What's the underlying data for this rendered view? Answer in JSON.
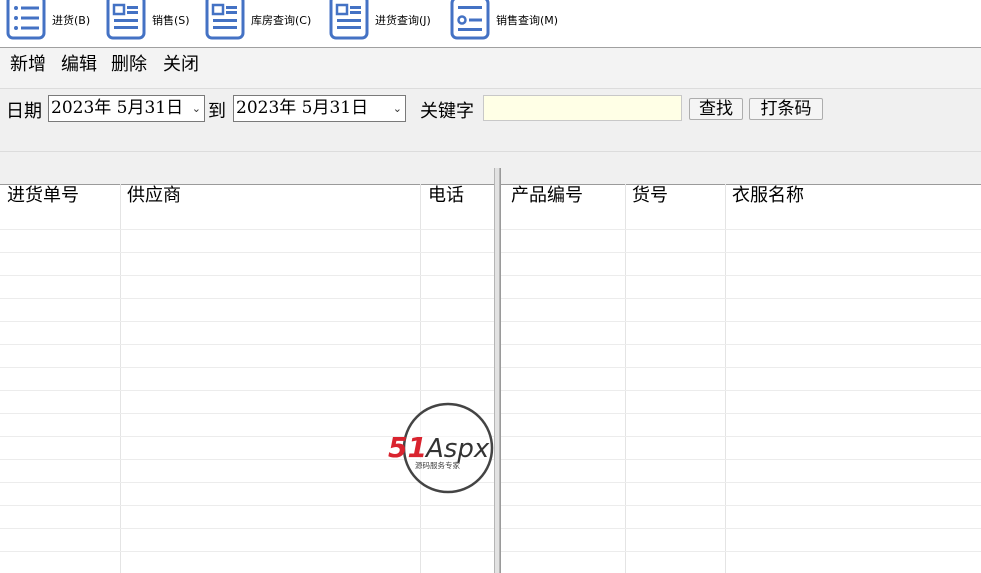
{
  "toolbar": {
    "items": [
      {
        "label": "进货(B)",
        "icon": "list-icon"
      },
      {
        "label": "销售(S)",
        "icon": "document-icon"
      },
      {
        "label": "库房查询(C)",
        "icon": "document-icon"
      },
      {
        "label": "进货查询(J)",
        "icon": "document-icon"
      },
      {
        "label": "销售查询(M)",
        "icon": "form-icon"
      }
    ]
  },
  "menu": {
    "add": "新增",
    "edit": "编辑",
    "delete": "删除",
    "close": "关闭"
  },
  "filter": {
    "date_label": "日期",
    "date_from": "2023年  5月31日",
    "to_label": "到",
    "date_to": "2023年  5月31日",
    "keyword_label": "关键字",
    "keyword_value": "",
    "search_button": "查找",
    "barcode_button": "打条码"
  },
  "left_grid": {
    "columns": [
      "进货单号",
      "供应商",
      "电话"
    ]
  },
  "right_grid": {
    "columns": [
      "产品编号",
      "货号",
      "衣服名称"
    ]
  },
  "watermark": {
    "brand_51": "51",
    "brand_aspx": "Aspx",
    "tagline": "源码服务专家"
  },
  "colors": {
    "icon_blue": "#4472c4",
    "keyword_bg": "#ffffe6",
    "watermark_red": "#d9232e",
    "watermark_green": "#2aa84a"
  }
}
